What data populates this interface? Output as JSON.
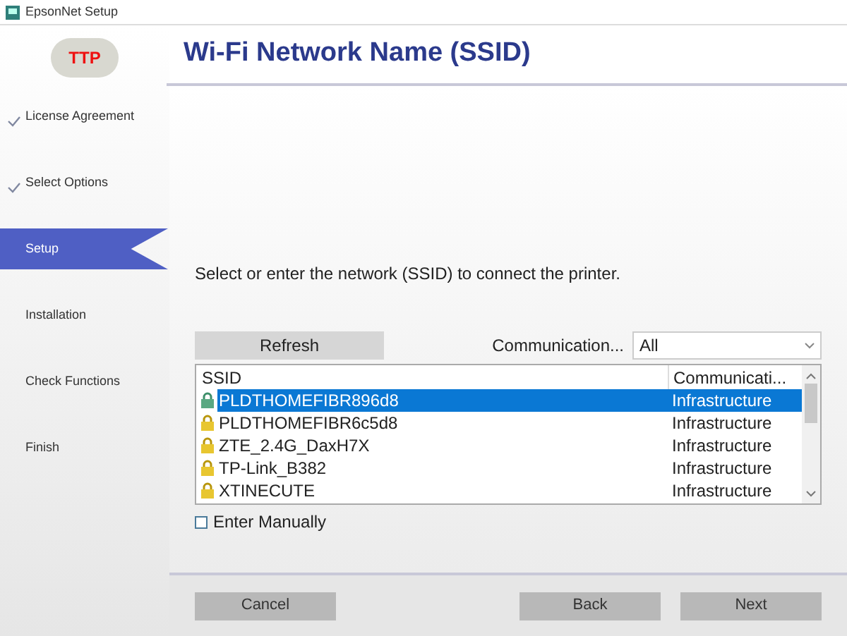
{
  "window": {
    "title": "EpsonNet Setup"
  },
  "logo": {
    "text": "TTP"
  },
  "sidebar": {
    "items": [
      {
        "label": "License Agreement",
        "checked": true,
        "selected": false
      },
      {
        "label": "Select Options",
        "checked": true,
        "selected": false
      },
      {
        "label": "Setup",
        "checked": false,
        "selected": true
      },
      {
        "label": "Installation",
        "checked": false,
        "selected": false
      },
      {
        "label": "Check Functions",
        "checked": false,
        "selected": false
      },
      {
        "label": "Finish",
        "checked": false,
        "selected": false
      }
    ]
  },
  "page_title": "Wi-Fi Network Name (SSID)",
  "instruction": "Select or enter the network (SSID) to connect the printer.",
  "refresh_button": "Refresh",
  "filter": {
    "label": "Communication...",
    "value": "All"
  },
  "table": {
    "columns": [
      "SSID",
      "Communicati..."
    ],
    "rows": [
      {
        "ssid": "PLDTHOMEFIBR896d8",
        "mode": "Infrastructure",
        "selected": true
      },
      {
        "ssid": "PLDTHOMEFIBR6c5d8",
        "mode": "Infrastructure",
        "selected": false
      },
      {
        "ssid": "ZTE_2.4G_DaxH7X",
        "mode": "Infrastructure",
        "selected": false
      },
      {
        "ssid": "TP-Link_B382",
        "mode": "Infrastructure",
        "selected": false
      },
      {
        "ssid": "XTINECUTE",
        "mode": "Infrastructure",
        "selected": false
      }
    ]
  },
  "enter_manually": {
    "label": "Enter Manually",
    "checked": false
  },
  "buttons": {
    "cancel": "Cancel",
    "back": "Back",
    "next": "Next"
  }
}
